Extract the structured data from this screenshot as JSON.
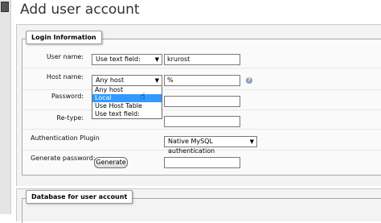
{
  "page": {
    "title": "Add user account"
  },
  "login_section": {
    "legend": "Login Information",
    "username": {
      "label": "User name:",
      "mode": "Use text field:",
      "value": "krurost"
    },
    "hostname": {
      "label": "Host name:",
      "mode": "Any host",
      "value": "%",
      "options": [
        "Any host",
        "Local",
        "Use Host Table",
        "Use text field:"
      ],
      "highlighted_option": "Local"
    },
    "password": {
      "label": "Password:",
      "value": ""
    },
    "retype": {
      "label": "Re-type:",
      "value": ""
    },
    "auth_plugin": {
      "label": "Authentication Plugin",
      "value": "Native MySQL authentication"
    },
    "generate": {
      "label": "Generate password:",
      "button": "Generate",
      "value": ""
    }
  },
  "database_section": {
    "legend": "Database for user account"
  },
  "colors": {
    "highlight": "#3399ff",
    "panel_bg": "#f3f3f3",
    "border": "#a9a9a9"
  }
}
